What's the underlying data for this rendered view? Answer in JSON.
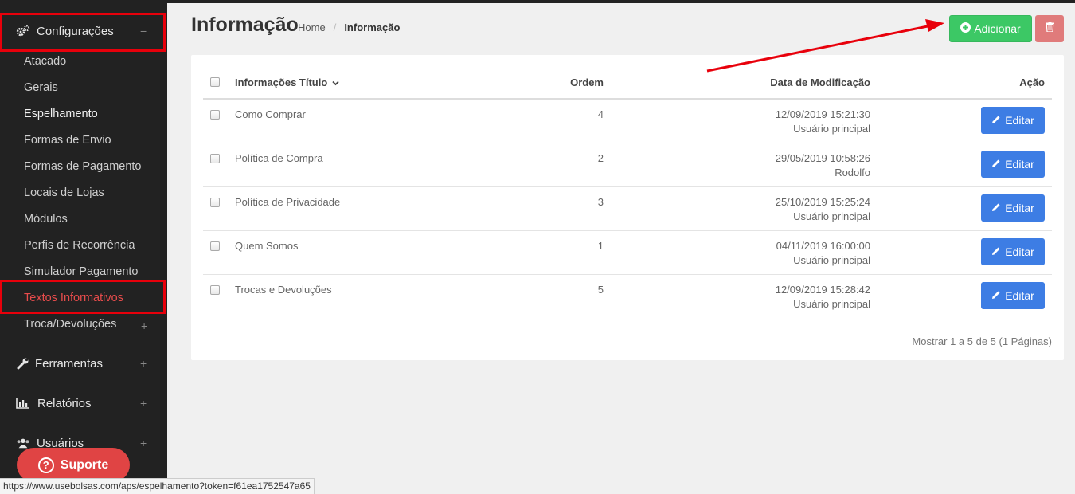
{
  "sidebar": {
    "configuracoes": {
      "label": "Configurações",
      "toggle": "−"
    },
    "items": [
      {
        "label": "Atacado"
      },
      {
        "label": "Gerais"
      },
      {
        "label": "Espelhamento"
      },
      {
        "label": "Formas de Envio"
      },
      {
        "label": "Formas de Pagamento"
      },
      {
        "label": "Locais de Lojas"
      },
      {
        "label": "Módulos"
      },
      {
        "label": "Perfis de Recorrência"
      },
      {
        "label": "Simulador Pagamento"
      },
      {
        "label": "Textos Informativos"
      },
      {
        "label": "Troca/Devoluções",
        "toggle": "+"
      }
    ],
    "ferramentas": {
      "label": "Ferramentas",
      "toggle": "+"
    },
    "relatorios": {
      "label": "Relatórios",
      "toggle": "+"
    },
    "usuarios": {
      "label": "Usuários",
      "toggle": "+"
    }
  },
  "header": {
    "title": "Informação",
    "breadcrumb_home": "Home",
    "breadcrumb_sep": "/",
    "breadcrumb_current": "Informação",
    "add_label": "Adicionar"
  },
  "table": {
    "columns": {
      "title": "Informações Título",
      "order": "Ordem",
      "modified": "Data de Modificação",
      "action": "Ação"
    },
    "edit_label": "Editar",
    "rows": [
      {
        "title": "Como Comprar",
        "order": "4",
        "date": "12/09/2019 15:21:30",
        "user": "Usuário principal"
      },
      {
        "title": "Política de Compra",
        "order": "2",
        "date": "29/05/2019 10:58:26",
        "user": "Rodolfo"
      },
      {
        "title": "Política de Privacidade",
        "order": "3",
        "date": "25/10/2019 15:25:24",
        "user": "Usuário principal"
      },
      {
        "title": "Quem Somos",
        "order": "1",
        "date": "04/11/2019 16:00:00",
        "user": "Usuário principal"
      },
      {
        "title": "Trocas e Devoluções",
        "order": "5",
        "date": "12/09/2019 15:28:42",
        "user": "Usuário principal"
      }
    ],
    "pagination": "Mostrar 1 a 5 de 5 (1 Páginas)"
  },
  "support": {
    "label": "Suporte",
    "icon_glyph": "?"
  },
  "statusbar": {
    "url": "https://www.usebolsas.com/aps/espelhamento?token=f61ea1752547a65"
  },
  "colors": {
    "sidebar_bg": "#222222",
    "active_item": "#e84c4c",
    "add_button": "#3cc865",
    "delete_button": "#e07b7b",
    "edit_button": "#3d7de4",
    "annotation_red": "#e8000b"
  }
}
